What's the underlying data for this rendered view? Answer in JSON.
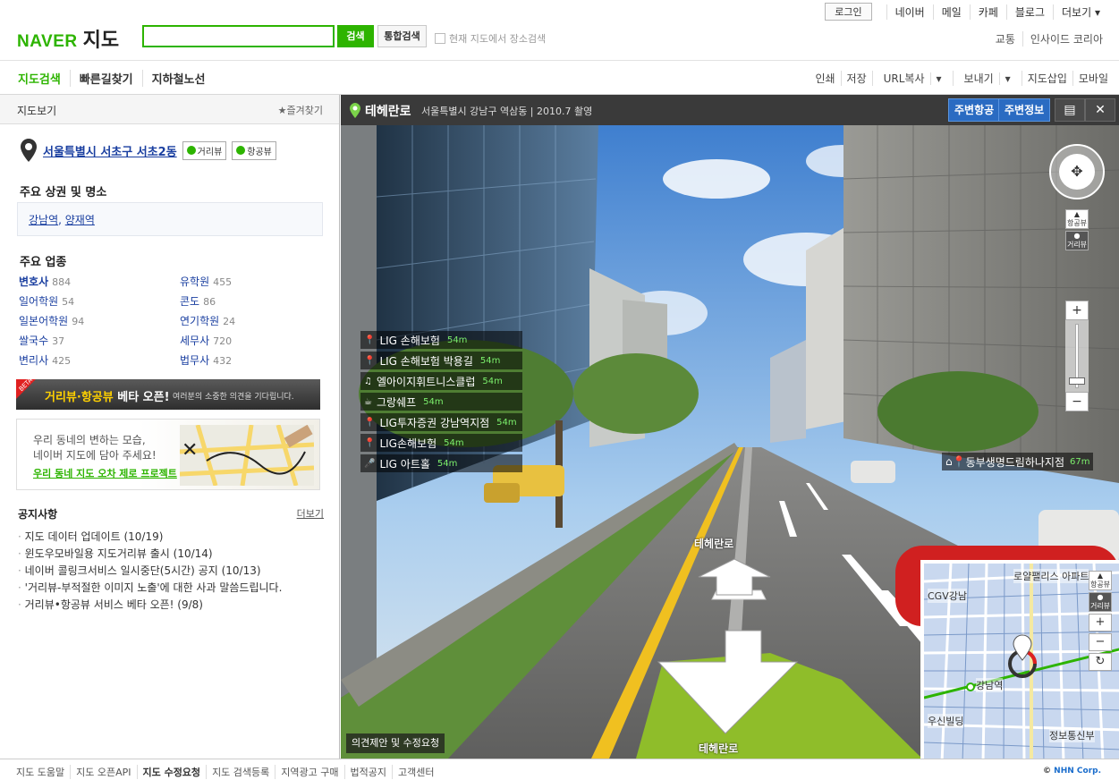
{
  "header": {
    "logo_naver": "NAVER",
    "logo_map": "지도",
    "search_placeholder": "",
    "search_button": "검색",
    "integrated_search_button": "통합검색",
    "current_map_search_label": "현재 지도에서 장소검색",
    "login_button": "로그인",
    "gnb": [
      "네이버",
      "메일",
      "카페",
      "블로그",
      "더보기"
    ],
    "sub_links": [
      "교통",
      "인사이드 코리아"
    ]
  },
  "nav": {
    "tabs": [
      "지도검색",
      "빠른길찾기",
      "지하철노선"
    ],
    "tools": [
      "인쇄",
      "저장",
      "URL복사",
      "보내기",
      "지도삽입",
      "모바일"
    ]
  },
  "left_panel": {
    "title": "지도보기",
    "favorite": "즐겨찾기",
    "address": "서울특별시 서초구 서초2동",
    "street_view_button": "거리뷰",
    "aerial_view_button": "항공뷰",
    "landmarks_heading": "주요 상권 및 명소",
    "landmarks": [
      "강남역",
      "양재역"
    ],
    "business_heading": "주요 업종",
    "businesses": [
      {
        "name": "변호사",
        "count": "884"
      },
      {
        "name": "유학원",
        "count": "455"
      },
      {
        "name": "일어학원",
        "count": "54"
      },
      {
        "name": "콘도",
        "count": "86"
      },
      {
        "name": "일본어학원",
        "count": "94"
      },
      {
        "name": "연기학원",
        "count": "24"
      },
      {
        "name": "쌀국수",
        "count": "37"
      },
      {
        "name": "세무사",
        "count": "720"
      },
      {
        "name": "변리사",
        "count": "425"
      },
      {
        "name": "법무사",
        "count": "432"
      }
    ],
    "banner1": {
      "beta_tag": "BETA",
      "main_yellow": "거리뷰·항공뷰",
      "main_white": " 베타 오픈!",
      "sub": "여러분의 소중한 의견을 기다립니다."
    },
    "banner2": {
      "line1": "우리 동네의 변하는 모습,",
      "line2": "네이버 지도에 담아 주세요!",
      "line3": "우리 동네 지도 오차 제로 프로젝트"
    },
    "notice": {
      "heading": "공지사항",
      "more": "더보기",
      "items": [
        "지도 데이터 업데이트 (10/19)",
        "윈도우모바일용 지도거리뷰 출시 (10/14)",
        "네이버 콜링크서비스 일시중단(5시간) 공지 (10/13)",
        "'거리뷰-부적절한 이미지 노출'에 대한 사과 말씀드립니다.",
        "거리뷰•항공뷰 서비스 베타 오픈! (9/8)"
      ]
    }
  },
  "street_view": {
    "road_name": "테헤란로",
    "location": "서울특별시 강남구 역삼동",
    "date": "2010.7 촬영",
    "nearby_aerial_button": "주변항공",
    "nearby_info_button": "주변정보",
    "pois": [
      {
        "icon": "pin-icon",
        "name": "LIG 손해보험",
        "dist": "54m"
      },
      {
        "icon": "pin-icon",
        "name": "LIG 손해보험 박용길",
        "dist": "54m"
      },
      {
        "icon": "music-icon",
        "name": "엘아이지휘트니스클럽",
        "dist": "54m"
      },
      {
        "icon": "food-icon",
        "name": "그랑쉐프",
        "dist": "54m"
      },
      {
        "icon": "pin-icon",
        "name": "LIG투자증권 강남역지점",
        "dist": "54m"
      },
      {
        "icon": "pin-icon",
        "name": "LIG손해보험",
        "dist": "54m"
      },
      {
        "icon": "mic-icon",
        "name": "LIG 아트홀",
        "dist": "54m"
      }
    ],
    "poi_right": {
      "name": "동부생명드림하나지점",
      "dist": "67m"
    },
    "road_label_forward": "테헤란로",
    "road_label_back": "테헤란로",
    "feedback_button": "의견제안 및 수정요청",
    "aerial_control": "항공뷰",
    "street_control": "거리뷰",
    "minimap": {
      "labels": [
        "로얄팰리스 아파트",
        "CGV강남",
        "강남역",
        "우신빌딩",
        "정보통신부"
      ],
      "aerial": "항공뷰",
      "street": "거리뷰"
    }
  },
  "footer": {
    "links": [
      "지도 도움말",
      "지도 오픈API",
      "지도 수정요청",
      "지도 검색등록",
      "지역광고 구매",
      "법적공지",
      "고객센터"
    ],
    "copyright_prefix": "©",
    "copyright": "NHN Corp."
  }
}
